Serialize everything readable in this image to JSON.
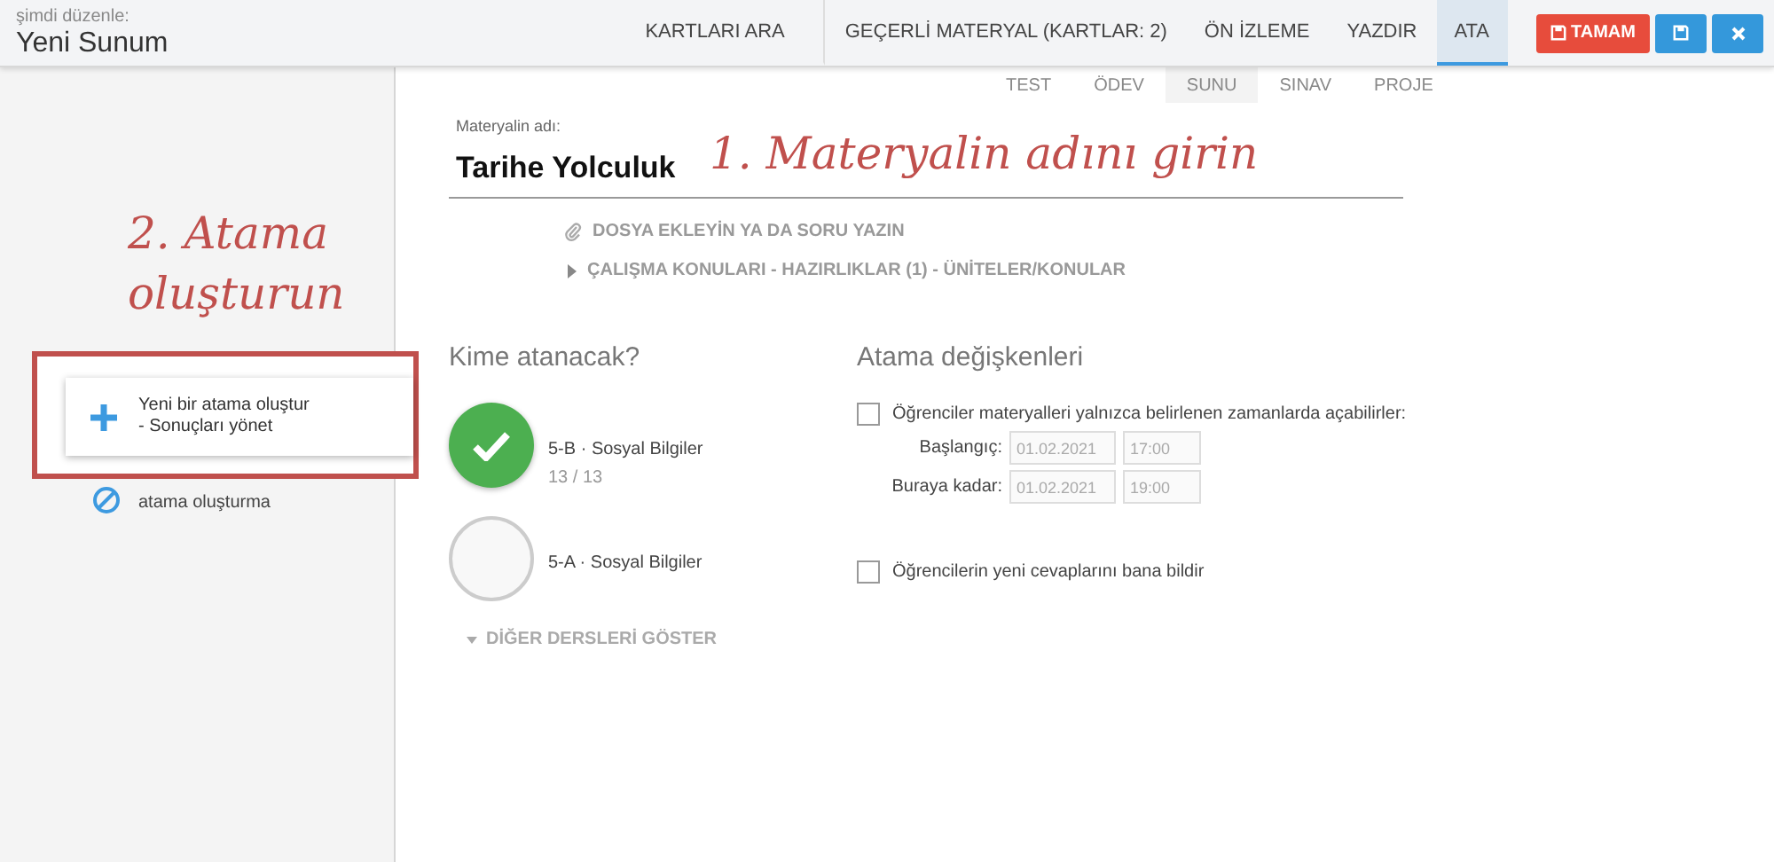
{
  "header": {
    "caption": "şimdi düzenle:",
    "title": "Yeni Sunum",
    "tabs": [
      {
        "label": "KARTLARI ARA",
        "selected": false
      },
      {
        "label": "GEÇERLİ MATERYAL (KARTLAR: 2)",
        "selected": false
      },
      {
        "label": "ÖN İZLEME",
        "selected": false
      },
      {
        "label": "YAZDIR",
        "selected": false
      },
      {
        "label": "ATA",
        "selected": true
      }
    ],
    "buttons": [
      {
        "kind": "done",
        "label": "TAMAM"
      },
      {
        "kind": "save"
      },
      {
        "kind": "close"
      }
    ]
  },
  "sidebar": {
    "actions": [
      {
        "kind": "create",
        "lines": [
          "Yeni bir atama oluştur",
          "- Sonuçları yönet"
        ]
      },
      {
        "kind": "none",
        "lines": [
          "atama oluşturma"
        ]
      }
    ]
  },
  "material_types": [
    {
      "label": "TEST",
      "selected": false
    },
    {
      "label": "ÖDEV",
      "selected": false
    },
    {
      "label": "SUNU",
      "selected": true
    },
    {
      "label": "SINAV",
      "selected": false
    },
    {
      "label": "PROJE",
      "selected": false
    }
  ],
  "name_field": {
    "label": "Materyalin adı:",
    "value": "Tarihe Yolculuk"
  },
  "attach_link": "DOSYA EKLEYİN YA DA SORU YAZIN",
  "topics_link": {
    "label": "ÇALIŞMA KONULARI - HAZIRLIKLAR (1) - ÜNİTELER/KONULAR",
    "expanded": false
  },
  "recipients": {
    "title": "Kime atanacak?",
    "classes": [
      {
        "name": "5-B · Sosyal Bilgiler",
        "count": "13 / 13",
        "selected": true
      },
      {
        "name": "5-A · Sosyal Bilgiler",
        "selected": false
      }
    ],
    "more_link": "DİĞER DERSLERİ GÖSTER"
  },
  "settings": {
    "title": "Atama değişkenleri",
    "options": [
      {
        "kind": "schedule",
        "label": "Öğrenciler materyalleri yalnızca belirlenen zamanlarda açabilirler:",
        "checked": false,
        "rows": [
          {
            "label": "Başlangıç:",
            "date": "01.02.2021",
            "time": "17:00"
          },
          {
            "label": "Buraya kadar:",
            "date": "01.02.2021",
            "time": "19:00"
          }
        ]
      },
      {
        "kind": "plain",
        "label": "Öğrencilerin yeni cevaplarını bana bildir",
        "checked": false
      }
    ]
  },
  "annotations": [
    "1. Materyalin adını girin",
    "2. Atama oluşturun"
  ]
}
